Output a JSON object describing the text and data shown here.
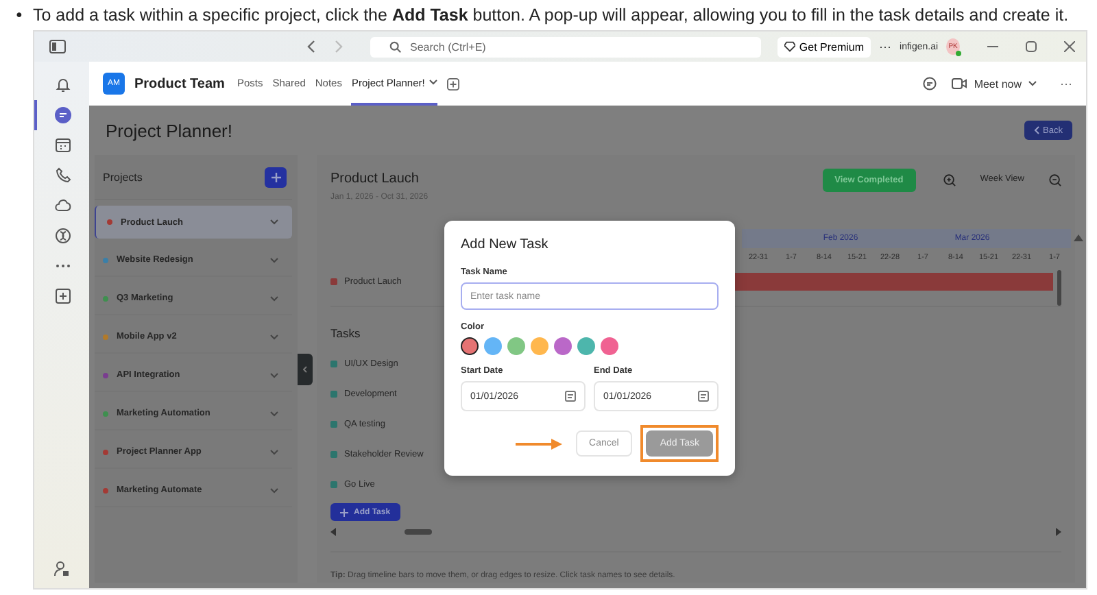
{
  "instruction": {
    "bullet": "•",
    "text": "To add a task within a specific project, click the **Add Task** button. A pop-up will appear, allowing you to fill in the task details and create it."
  },
  "titlebar": {
    "search_placeholder": "Search (Ctrl+E)",
    "premium": "Get Premium",
    "more": "···",
    "org": "infigen.ai",
    "avatar": "PK"
  },
  "rail": {
    "items": [
      {
        "kind": "bell",
        "selected": false
      },
      {
        "kind": "chat",
        "selected": true
      },
      {
        "kind": "calendar",
        "selected": false
      },
      {
        "kind": "phone",
        "selected": false
      },
      {
        "kind": "cloud",
        "selected": false
      },
      {
        "kind": "loop",
        "selected": false
      },
      {
        "kind": "dots",
        "selected": false
      },
      {
        "kind": "plus",
        "selected": false
      }
    ]
  },
  "team": {
    "avatar": "AM",
    "name": "Product Team",
    "tabs": [
      {
        "label": "Posts",
        "selected": false
      },
      {
        "label": "Shared",
        "selected": false
      },
      {
        "label": "Notes",
        "selected": false
      },
      {
        "label": "Project Planner!",
        "selected": true
      }
    ],
    "meet": "Meet now",
    "more": "···"
  },
  "planner": {
    "title": "Project Planner!",
    "back": "Back",
    "projects": {
      "title": "Projects",
      "items": [
        {
          "name": "Product Lauch",
          "color": "#a33a35",
          "selected": true
        },
        {
          "name": "Website Redesign",
          "color": "#3a7fa8",
          "selected": false
        },
        {
          "name": "Q3 Marketing",
          "color": "#3f8f4f",
          "selected": false
        },
        {
          "name": "Mobile App v2",
          "color": "#b27a2a",
          "selected": false
        },
        {
          "name": "API Integration",
          "color": "#7a3d8f",
          "selected": false
        },
        {
          "name": "Marketing Automation",
          "color": "#3f8f4f",
          "selected": false
        },
        {
          "name": "Project Planner App",
          "color": "#a33a35",
          "selected": false
        },
        {
          "name": "Marketing Automate",
          "color": "#a33a35",
          "selected": false
        }
      ]
    },
    "project": {
      "title": "Product Lauch",
      "dates": "Jan 1, 2026 - Oct 31, 2026",
      "view_completed": "View Completed",
      "view": "Week View"
    },
    "timeline": {
      "weeks_before": [
        "22-31"
      ],
      "months": [
        {
          "label": "Feb 2026",
          "weeks": [
            "1-7",
            "8-14",
            "15-21",
            "22-28"
          ]
        },
        {
          "label": "Mar 2026",
          "weeks": [
            "1-7",
            "8-14",
            "15-21",
            "22-31"
          ]
        }
      ],
      "weeks_after": [
        "1-7"
      ],
      "rows": [
        {
          "name": "Product Lauch",
          "color": "#8a3a3a"
        }
      ]
    },
    "tasks": {
      "title": "Tasks",
      "items": [
        "UI/UX Design",
        "Development",
        "QA testing",
        "Stakeholder Review",
        "Go Live"
      ],
      "add": "Add Task"
    },
    "tip": "**Tip:** Drag timeline bars to move them, or drag edges to resize. Click task names to see details."
  },
  "dialog": {
    "title": "Add New Task",
    "task_name": {
      "label": "Task Name",
      "placeholder": "Enter task name"
    },
    "color_label": "Color",
    "colors": [
      {
        "color": "#e57373",
        "selected": true
      },
      {
        "color": "#64b5f6",
        "selected": false
      },
      {
        "color": "#81c784",
        "selected": false
      },
      {
        "color": "#ffb74d",
        "selected": false
      },
      {
        "color": "#ba68c8",
        "selected": false
      },
      {
        "color": "#4db6ac",
        "selected": false
      },
      {
        "color": "#f06292",
        "selected": false
      }
    ],
    "start": {
      "label": "Start Date",
      "value": "01/01/2026"
    },
    "end": {
      "label": "End Date",
      "value": "01/01/2026"
    },
    "cancel": "Cancel",
    "submit": {
      "label": "Add Task",
      "disabled": true,
      "highlighted": true
    }
  }
}
